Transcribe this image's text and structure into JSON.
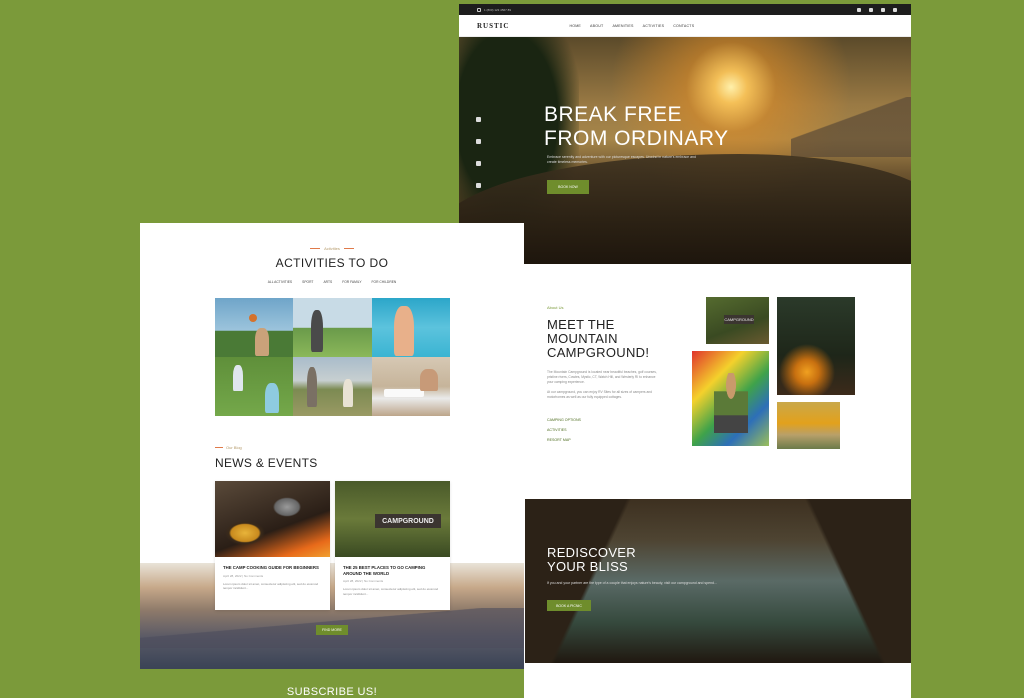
{
  "home": {
    "topbar": {
      "phone": "1 (800) 123 4567 89"
    },
    "logo": "RUSTIC",
    "nav": [
      "HOME",
      "ABOUT",
      "AMENITIES",
      "ACTIVITIES",
      "CONTACTS"
    ],
    "hero": {
      "title": "BREAK FREE FROM ORDINARY",
      "text": "Embrace serenity and adventure with our picturesque escapes. Unwind in nature's embrace and create timeless memories.",
      "button": "BOOK NOW"
    },
    "about": {
      "eyebrow": "About Us",
      "title": "MEET THE MOUNTAIN CAMPGROUND!",
      "text1": "The Mountain Campground is located near beautiful beaches, golf courses, pristine rivers, Cowtes, Mystic, CT, Watch Hill, and Westerly RI to enhance your camping experience.",
      "text2": "At our campground, you can enjoy RV Sites for all sizes of campers and motorhomes as well as our fully equipped cottages.",
      "links": [
        "CAMPING OPTIONS",
        "ACTIVITIES",
        "RESORT MAP"
      ],
      "sign": "CAMPGROUND"
    },
    "bliss": {
      "title": "REDISCOVER YOUR BLISS",
      "text": "If you and your partner are the type of a couple that enjoys nature's beauty, visit our campground and spend...",
      "button": "BOOK A PICNIC"
    }
  },
  "activities": {
    "eyebrow": "Activities",
    "title": "ACTIVITIES TO DO",
    "filters": [
      "ALL ACTIVITIES",
      "SPORT",
      "ARTS",
      "FOR FAMILY",
      "FOR CHILDREN"
    ],
    "blog_eyebrow": "Our Blog",
    "blog_title": "NEWS & EVENTS",
    "cards": [
      {
        "title": "THE CAMP COOKING GUIDE FOR BEGINNERS",
        "date": "April 28, 2022 | No Comments",
        "text": "Lorem ipsum dolor sit amet, consectetur adipiscing elit, sed do eiusmod tempor incididunt..."
      },
      {
        "title": "THE 25 BEST PLACES TO GO CAMPING AROUND THE WORLD",
        "date": "April 28, 2022 | No Comments",
        "text": "Lorem ipsum dolor sit amet, consectetur adipiscing elit, sed do eiusmod tempor incididunt...",
        "sign": "CAMPGROUND"
      }
    ],
    "button": "FIND MORE"
  },
  "subscribe": {
    "title": "SUBSCRIBE US!"
  },
  "colors": {
    "background": "#7b9a3a",
    "accent": "#6f8d2c",
    "dark": "#1d1d1d"
  }
}
